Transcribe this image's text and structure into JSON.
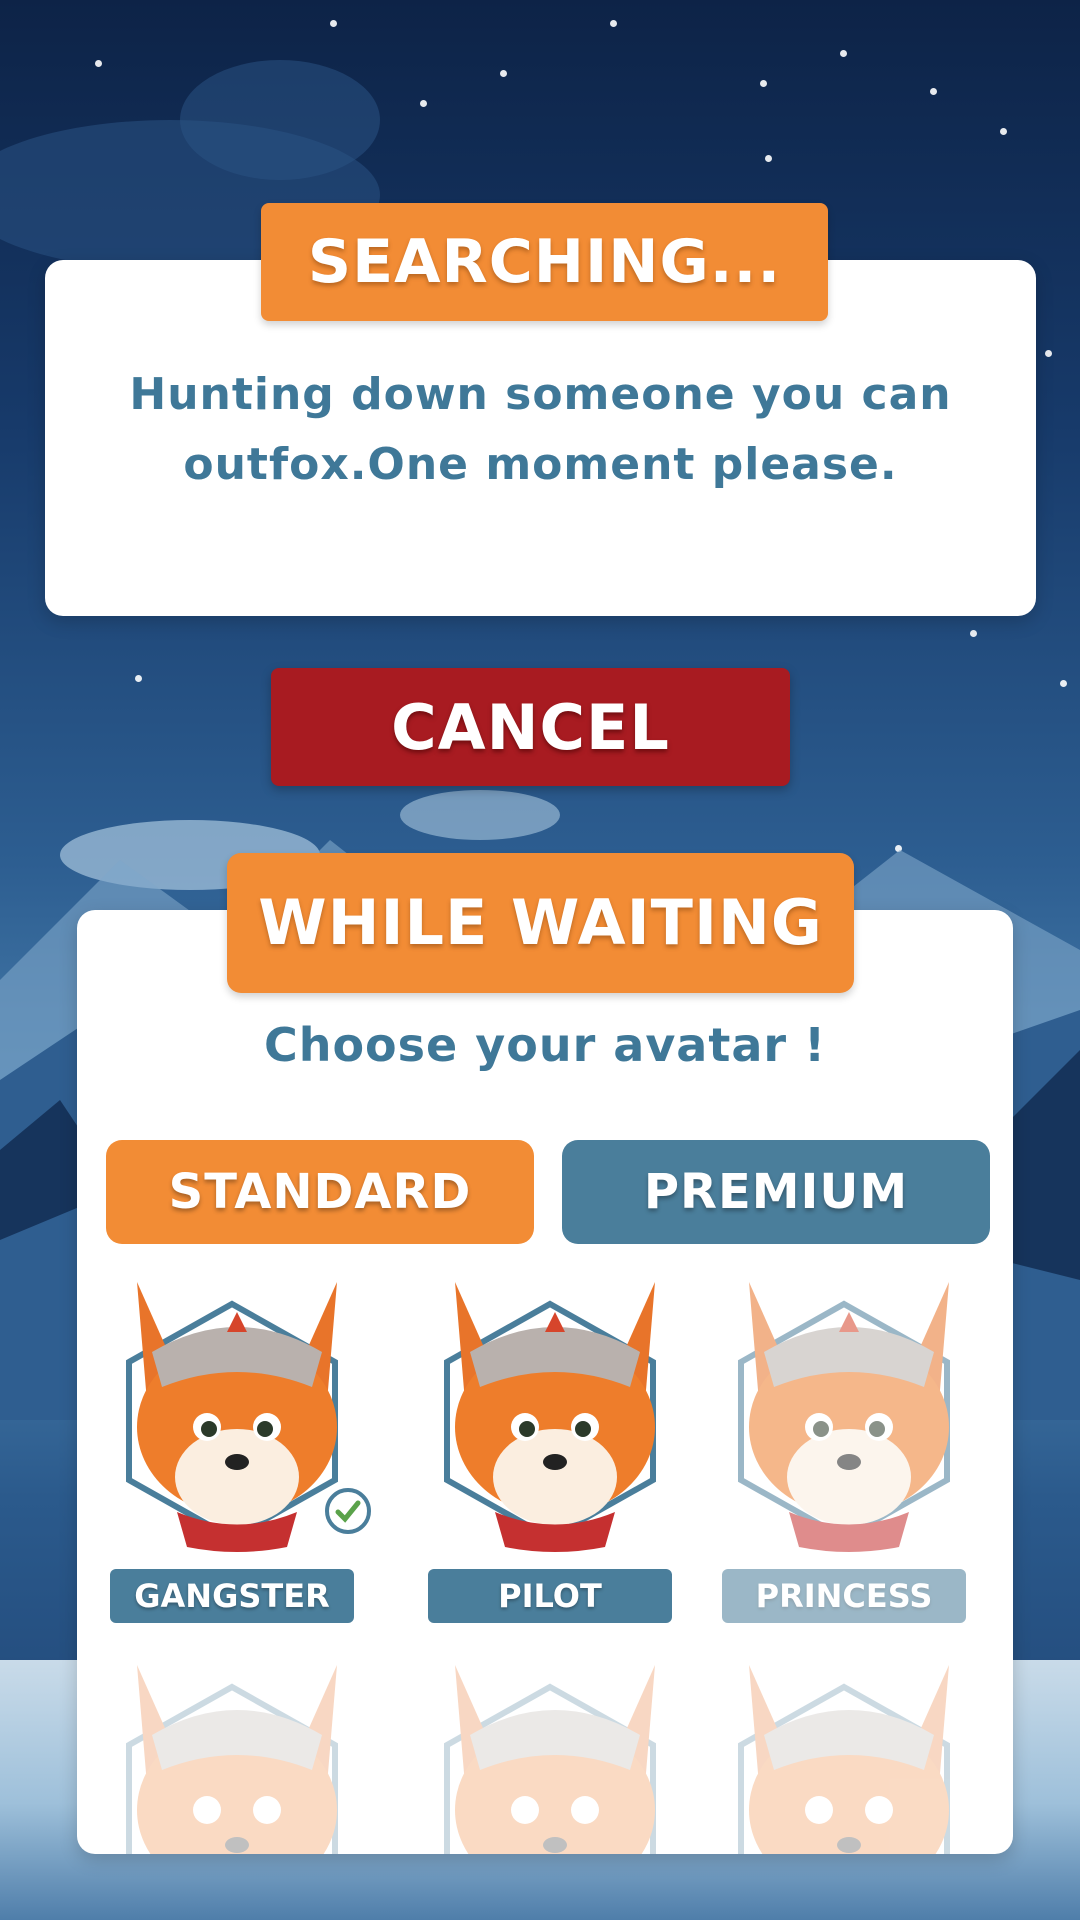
{
  "search_panel": {
    "title": "SEARCHING...",
    "message_line1": "Hunting down someone you can",
    "message_line2": "outfox.One moment please."
  },
  "cancel_label": "CANCEL",
  "wait_panel": {
    "title": "WHILE WAITING",
    "prompt": "Choose your avatar !",
    "tabs": [
      {
        "label": "STANDARD",
        "selected": true
      },
      {
        "label": "PREMIUM",
        "selected": false
      }
    ],
    "avatars": [
      {
        "label": "GANGSTER",
        "selected": true
      },
      {
        "label": "PILOT",
        "selected": false
      },
      {
        "label": "PRINCESS",
        "selected": false,
        "locked": true
      }
    ]
  },
  "colors": {
    "accent_orange": "#f28c35",
    "cancel_red": "#a81b21",
    "teal_blue": "#4a7e9b",
    "text_blue": "#3f7898"
  }
}
